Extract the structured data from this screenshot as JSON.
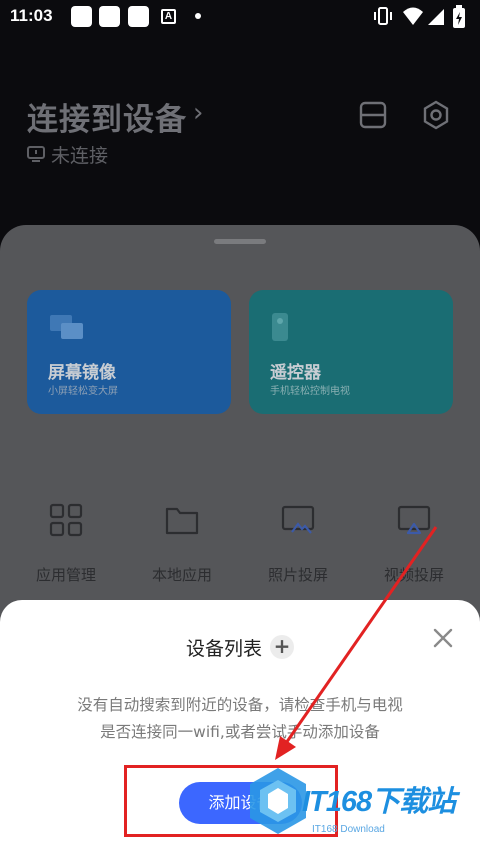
{
  "status_bar": {
    "time": "11:03"
  },
  "header": {
    "title": "连接到设备",
    "connection_status": "未连接"
  },
  "cards": [
    {
      "title": "屏幕镜像",
      "subtitle": "小屏轻松变大屏",
      "color": "#1c5a9c"
    },
    {
      "title": "遥控器",
      "subtitle": "手机轻松控制电视",
      "color": "#1a6d73"
    }
  ],
  "tools": [
    {
      "label": "应用管理",
      "icon": "grid-icon"
    },
    {
      "label": "本地应用",
      "icon": "folder-icon"
    },
    {
      "label": "照片投屏",
      "icon": "photo-icon"
    },
    {
      "label": "视频投屏",
      "icon": "video-icon"
    }
  ],
  "dialog": {
    "title": "设备列表",
    "message_line1": "没有自动搜索到附近的设备，请检查手机与电视",
    "message_line2": "是否连接同一wifi,或者尝试手动添加设备",
    "add_button": "添加设备",
    "accent_color": "#3c67ff"
  },
  "watermark": {
    "text": "IT168下载站",
    "sub": "IT168 Download"
  },
  "annotation_color": "#e22222"
}
